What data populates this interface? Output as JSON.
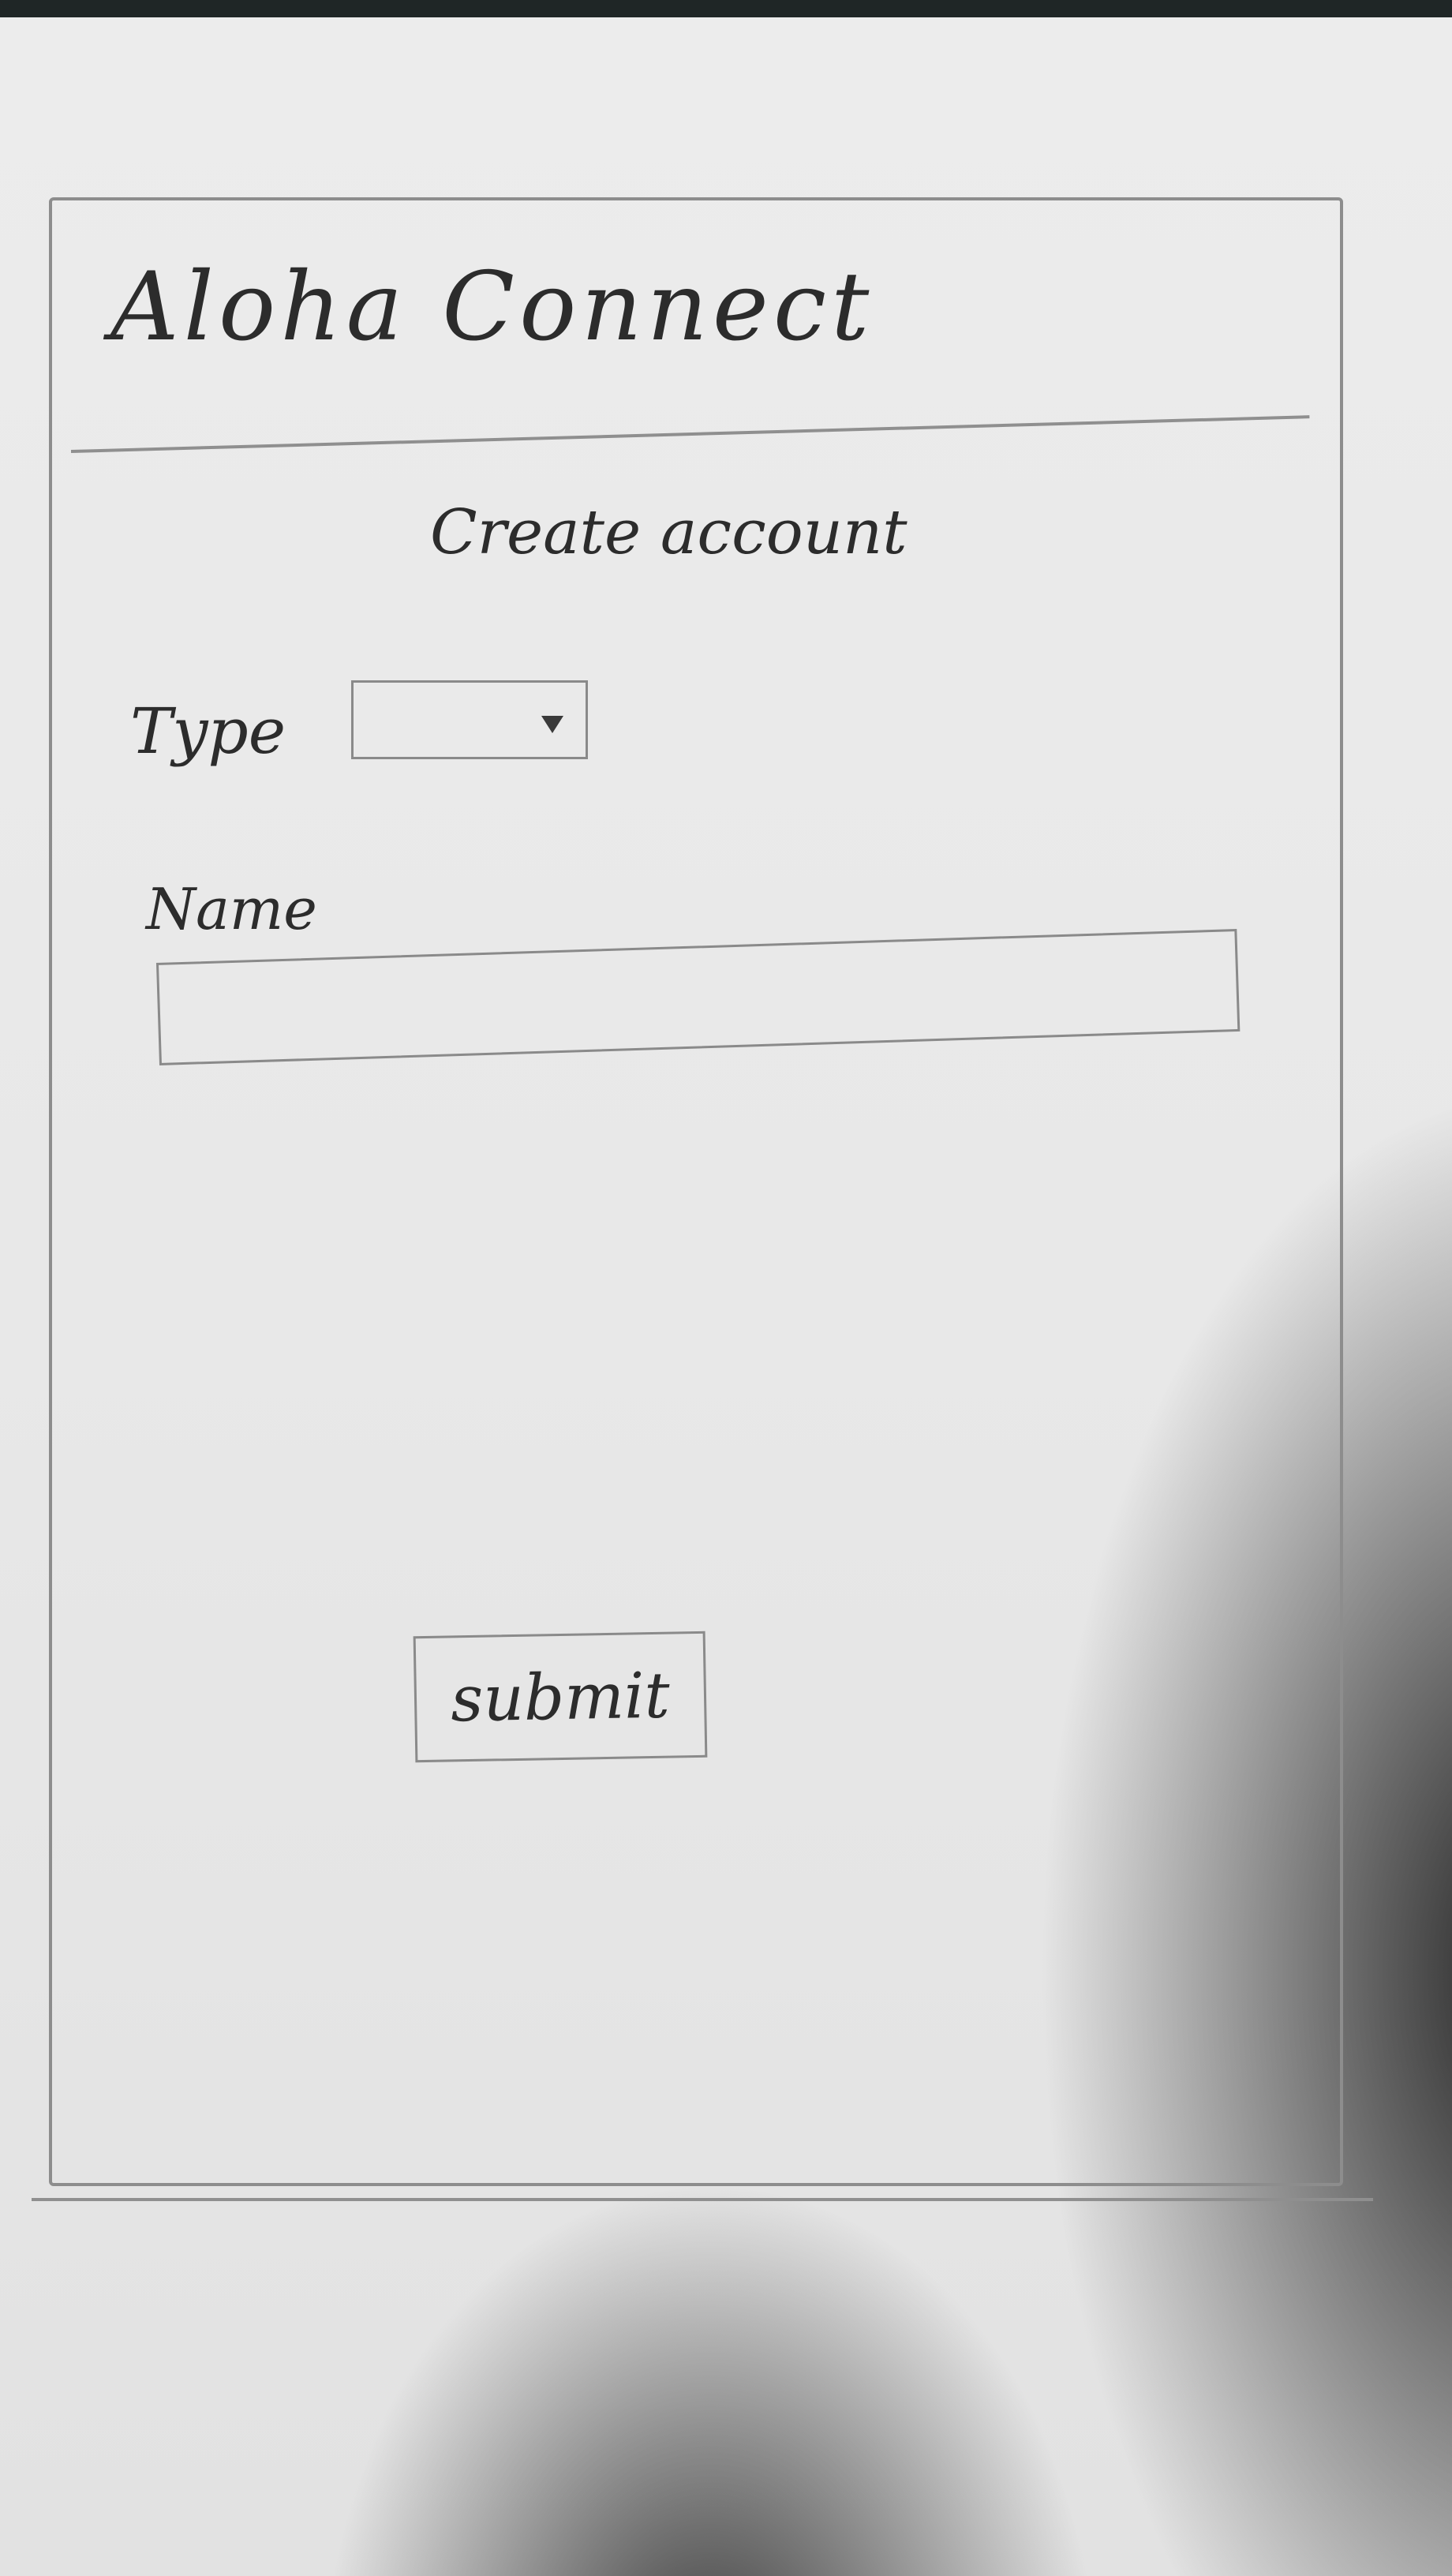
{
  "header": {
    "title": "Aloha Connect"
  },
  "main": {
    "heading": "Create account"
  },
  "form": {
    "type": {
      "label": "Type",
      "value": ""
    },
    "name": {
      "label": "Name",
      "value": "",
      "placeholder": ""
    },
    "submit_label": "submit"
  },
  "icons": {
    "type_dropdown": "chevron-down-icon"
  },
  "colors": {
    "pencil": "#8d8d8d",
    "ink": "#2c2c2c",
    "paper": "#e9e9e9"
  }
}
